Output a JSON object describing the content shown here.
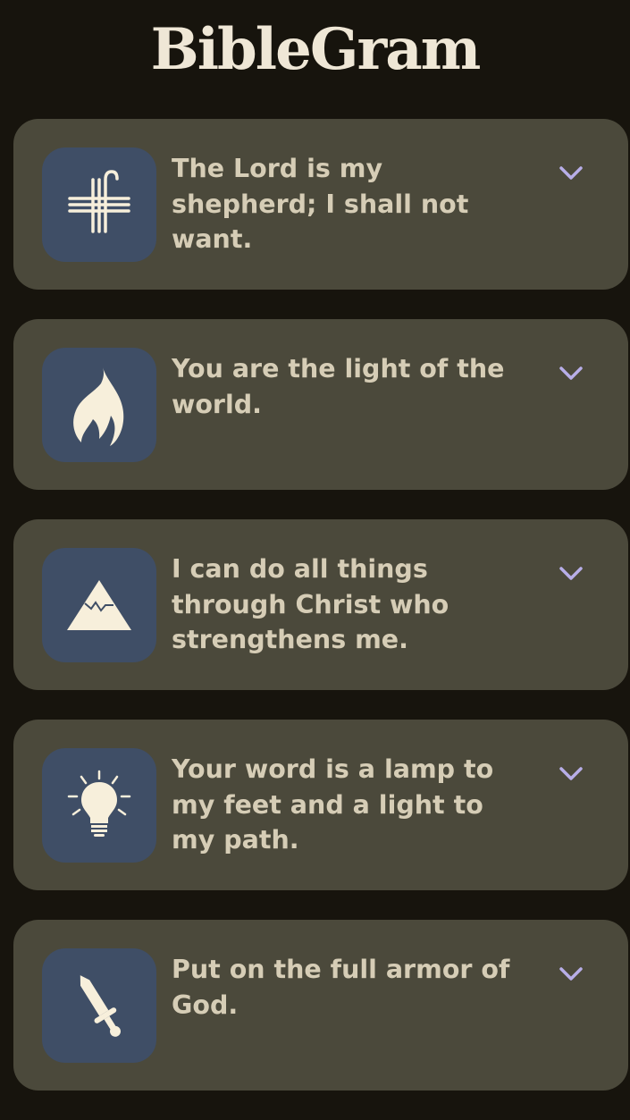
{
  "app": {
    "title": "BibleGram"
  },
  "colors": {
    "background": "#17140d",
    "card": "#4b493b",
    "icon_tile": "#3f4e66",
    "icon_glyph": "#f7efdb",
    "text": "#d6cdb6",
    "chevron": "#b8aee8"
  },
  "verses": [
    {
      "text": "The Lord is my shepherd; I shall not want.",
      "icon": "shepherd-staff-cross-icon"
    },
    {
      "text": "You are the light of the world.",
      "icon": "flame-icon"
    },
    {
      "text": "I can do all things through Christ who strengthens me.",
      "icon": "mountain-icon"
    },
    {
      "text": "Your word is a lamp to my feet and a light to my path.",
      "icon": "lightbulb-icon"
    },
    {
      "text": "Put on the full armor of God.",
      "icon": "sword-icon"
    }
  ]
}
